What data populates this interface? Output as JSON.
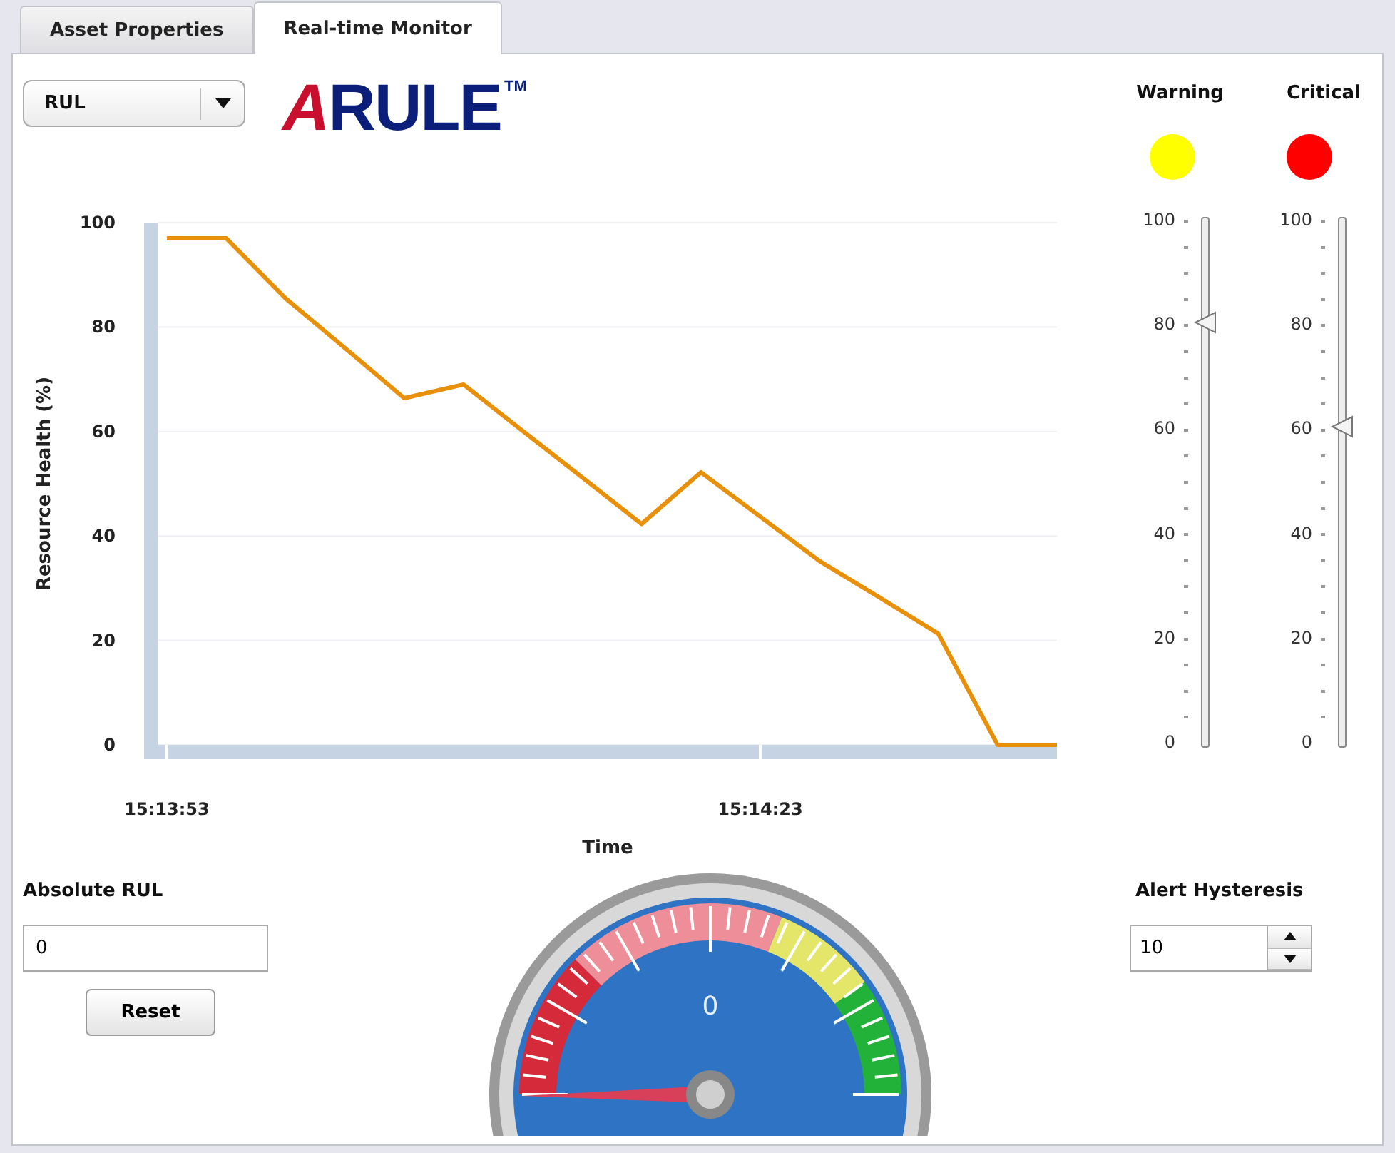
{
  "tabs": [
    {
      "label": "Asset Properties",
      "selected": false
    },
    {
      "label": "Real-time Monitor",
      "selected": true
    }
  ],
  "metric_select": {
    "value": "RUL"
  },
  "logo": {
    "parts": [
      "A",
      "RULE"
    ],
    "tm": "TM"
  },
  "chart": {
    "chart_data": {
      "type": "line",
      "xlabel": "Time",
      "ylabel": "Resource Health (%)",
      "categories": [
        "15:13:53",
        null,
        null,
        null,
        null,
        null,
        null,
        null,
        null,
        null,
        "15:14:23",
        null,
        null,
        null,
        null,
        null
      ],
      "series": [
        {
          "color": "#e8900a",
          "values": [
            97,
            97,
            85.5,
            76,
            66.4,
            69,
            60.1,
            51.2,
            42.3,
            52.2,
            43.7,
            35.2,
            28.3,
            21.3,
            0,
            0
          ]
        }
      ],
      "ylim": [
        0,
        100
      ],
      "yticks": [
        0,
        20,
        40,
        60,
        80,
        100
      ],
      "grid": true
    }
  },
  "thresholds": [
    {
      "label": "Warning",
      "color": "#ffff00",
      "level": 0.8,
      "scale": [
        "100",
        "80",
        "60",
        "40",
        "20",
        "0"
      ]
    },
    {
      "label": "Critical",
      "color": "#ff0000",
      "level": 0.6,
      "scale": [
        "100",
        "80",
        "60",
        "40",
        "20",
        "0"
      ]
    }
  ],
  "absolute_rul": {
    "label": "Absolute RUL",
    "value": "0",
    "button": "Reset"
  },
  "gauge": {
    "reading": "0"
  },
  "alert_hysteresis": {
    "label": "Alert Hysteresis",
    "value": "10"
  }
}
